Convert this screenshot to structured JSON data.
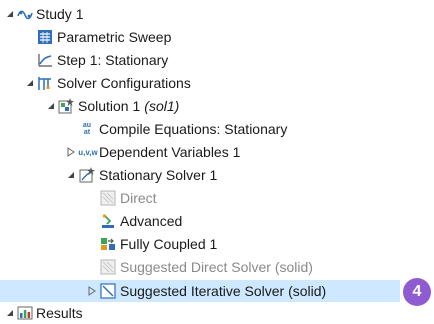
{
  "tree": {
    "study": {
      "label": "Study 1",
      "icon": "study-icon"
    },
    "parametric_sweep": {
      "label": "Parametric Sweep",
      "icon": "parametric-sweep-icon"
    },
    "step1": {
      "label": "Step 1: Stationary",
      "icon": "stationary-step-icon"
    },
    "solver_configurations": {
      "label": "Solver Configurations",
      "icon": "solver-configurations-icon"
    },
    "solution1": {
      "label": "Solution 1",
      "tag": "(sol1)",
      "icon": "solution-icon"
    },
    "compile_equations": {
      "label": "Compile Equations: Stationary",
      "icon": "compile-equations-icon",
      "icon_text_top": "au",
      "icon_text_bottom": "at"
    },
    "dependent_variables": {
      "label": "Dependent Variables 1",
      "icon": "dependent-variables-icon",
      "icon_text": "u,v,w"
    },
    "stationary_solver": {
      "label": "Stationary Solver 1",
      "icon": "stationary-solver-icon"
    },
    "direct": {
      "label": "Direct",
      "icon": "direct-icon",
      "disabled": true
    },
    "advanced": {
      "label": "Advanced",
      "icon": "advanced-icon"
    },
    "fully_coupled": {
      "label": "Fully Coupled 1",
      "icon": "fully-coupled-icon"
    },
    "suggested_direct": {
      "label": "Suggested Direct Solver (solid)",
      "icon": "suggested-direct-icon",
      "disabled": true
    },
    "suggested_iterative": {
      "label": "Suggested Iterative Solver (solid)",
      "icon": "suggested-iterative-icon",
      "selected": true
    },
    "results": {
      "label": "Results",
      "icon": "results-icon"
    }
  },
  "callout": {
    "number": "4"
  },
  "colors": {
    "selection": "#cde8ff",
    "callout": "#8f5bd1",
    "disabled_text": "#8a8a8a",
    "icon_blue": "#2f6fb8"
  }
}
